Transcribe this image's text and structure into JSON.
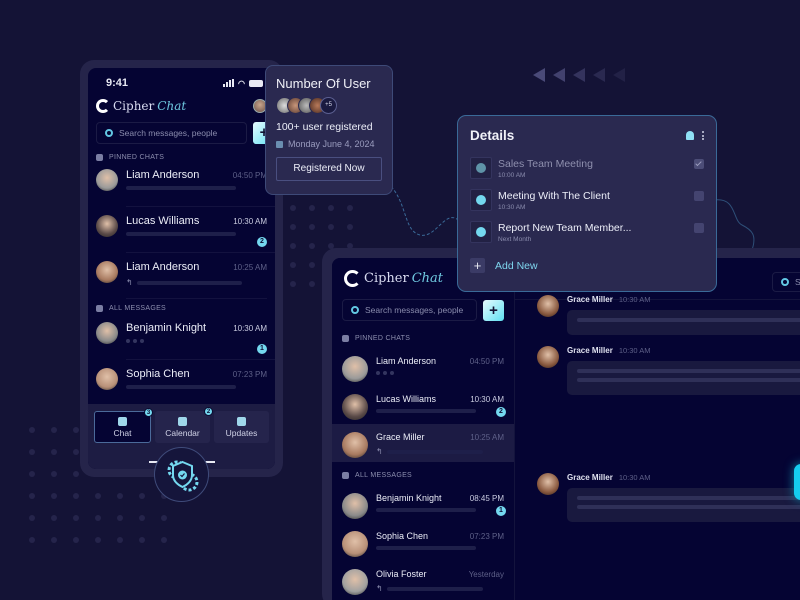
{
  "colors": {
    "background": "#141336",
    "panel": "#2a2950",
    "accent": "#74d8ef",
    "surface": "#050433"
  },
  "mobile": {
    "status_time": "9:41",
    "app_name": {
      "main": "Cipher",
      "script": "Chat"
    },
    "search_placeholder": "Search messages, people",
    "new_chat_icon": "plus-icon",
    "pinned_label": "PINNED CHATS",
    "all_label": "ALL MESSAGES",
    "pinned": [
      {
        "name": "Liam Anderson",
        "time": "04:50 PM",
        "preview": "bar",
        "badge": null
      },
      {
        "name": "Lucas Williams",
        "time": "10:30 AM",
        "preview": "bar",
        "badge": "2"
      },
      {
        "name": "Liam Anderson",
        "time": "10:25 AM",
        "preview": "reply",
        "badge": null
      }
    ],
    "all": [
      {
        "name": "Benjamin Knight",
        "time": "10:30 AM",
        "preview": "typing",
        "badge": "1"
      },
      {
        "name": "Sophia Chen",
        "time": "07:23 PM",
        "preview": "bar",
        "badge": null
      }
    ],
    "tabs": [
      {
        "label": "Chat",
        "badge": "3",
        "icon": "chat-icon",
        "active": true
      },
      {
        "label": "Calendar",
        "badge": "2",
        "icon": "calendar-icon",
        "active": false
      },
      {
        "label": "Updates",
        "badge": null,
        "icon": "updates-icon",
        "active": false
      }
    ]
  },
  "users_card": {
    "title": "Number Of User",
    "more_count": "+5",
    "count_text": "100+ user registered",
    "date": "Monday June 4, 2024",
    "button": "Registered Now"
  },
  "details": {
    "title": "Details",
    "tasks": [
      {
        "title": "Sales Team Meeting",
        "sub": "10:00 AM",
        "done": true
      },
      {
        "title": "Meeting With The Client",
        "sub": "10:30 AM",
        "done": false
      },
      {
        "title": "Report New Team Member...",
        "sub": "Next Month",
        "done": false
      }
    ],
    "add_new": "Add New"
  },
  "desktop": {
    "app_name": {
      "main": "Cipher",
      "script": "Chat"
    },
    "search_placeholder": "Search messages, people",
    "right_search_placeholder": "Se",
    "pinned_label": "PINNED CHATS",
    "all_label": "ALL MESSAGES",
    "pinned": [
      {
        "name": "Liam Anderson",
        "time": "04:50 PM",
        "preview": "typing",
        "badge": null
      },
      {
        "name": "Lucas Williams",
        "time": "10:30 AM",
        "preview": "bar",
        "badge": "2"
      },
      {
        "name": "Grace Miller",
        "time": "10:25 AM",
        "preview": "reply",
        "badge": null,
        "active": true
      }
    ],
    "all": [
      {
        "name": "Benjamin Knight",
        "time": "08:45 PM",
        "preview": "bar",
        "badge": "1"
      },
      {
        "name": "Sophia Chen",
        "time": "07:23 PM",
        "preview": "bar",
        "badge": null
      },
      {
        "name": "Olivia Foster",
        "time": "Yesterday",
        "preview": "reply",
        "badge": null
      }
    ],
    "messages": [
      {
        "sender": "Grace Miller",
        "time": "10:30 AM",
        "lines": 1
      },
      {
        "sender": "Grace Miller",
        "time": "10:30 AM",
        "lines": 2
      },
      {
        "sender": "Grace Miller",
        "time": "10:30 AM",
        "lines": 2
      }
    ]
  }
}
